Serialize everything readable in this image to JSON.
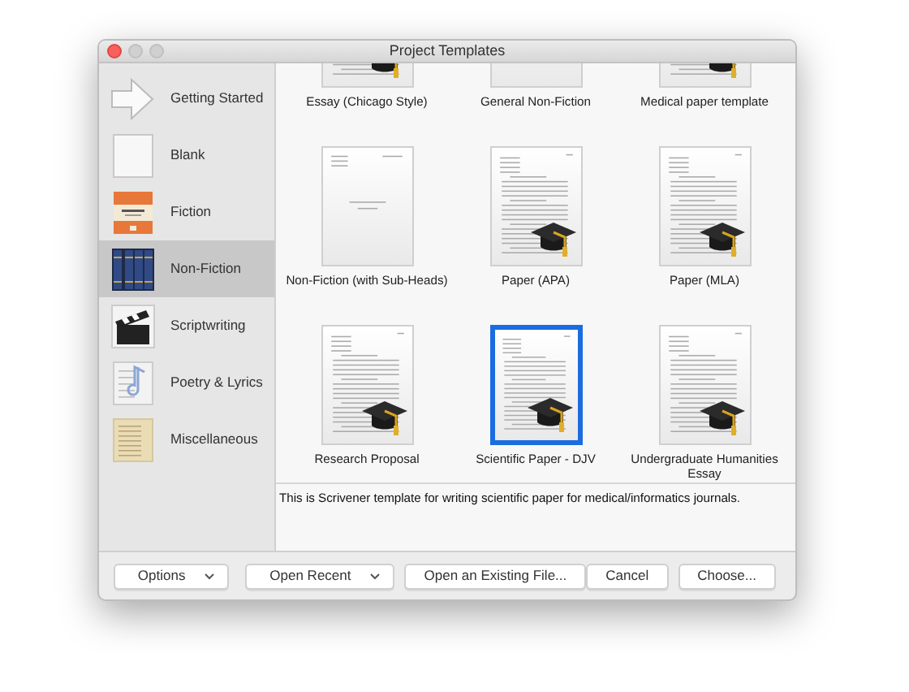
{
  "window": {
    "title": "Project Templates"
  },
  "sidebar": {
    "items": [
      {
        "label": "Getting Started",
        "kind": "arrow",
        "selected": false
      },
      {
        "label": "Blank",
        "kind": "blank",
        "selected": false
      },
      {
        "label": "Fiction",
        "kind": "cover",
        "selected": false
      },
      {
        "label": "Non-Fiction",
        "kind": "books",
        "selected": true
      },
      {
        "label": "Scriptwriting",
        "kind": "clapperboard",
        "selected": false
      },
      {
        "label": "Poetry & Lyrics",
        "kind": "music",
        "selected": false
      },
      {
        "label": "Miscellaneous",
        "kind": "parchment",
        "selected": false
      }
    ]
  },
  "templates": [
    {
      "name": "Essay (Chicago Style)",
      "kind": "paper",
      "cap": true,
      "selected": false
    },
    {
      "name": "General Non-Fiction",
      "kind": "plain",
      "cap": false,
      "selected": false
    },
    {
      "name": "Medical paper template",
      "kind": "paper",
      "cap": true,
      "selected": false
    },
    {
      "name": "Non-Fiction (with Sub-Heads)",
      "kind": "title",
      "cap": false,
      "selected": false
    },
    {
      "name": "Paper (APA)",
      "kind": "paper",
      "cap": true,
      "selected": false
    },
    {
      "name": "Paper (MLA)",
      "kind": "paper",
      "cap": true,
      "selected": false
    },
    {
      "name": "Research Proposal",
      "kind": "paper",
      "cap": true,
      "selected": false
    },
    {
      "name": "Scientific Paper - DJV",
      "kind": "paper",
      "cap": true,
      "selected": true
    },
    {
      "name": "Undergraduate Humanities Essay",
      "kind": "paper",
      "cap": true,
      "selected": false
    }
  ],
  "description": "This is Scrivener template for writing scientific paper for medical/informatics journals.",
  "buttons": [
    {
      "label": "Options",
      "kind": "popup"
    },
    {
      "label": "Open Recent",
      "kind": "popup"
    },
    {
      "label": "Open an Existing File...",
      "kind": "push"
    },
    {
      "label": "Cancel",
      "kind": "push"
    },
    {
      "label": "Choose...",
      "kind": "push"
    }
  ]
}
